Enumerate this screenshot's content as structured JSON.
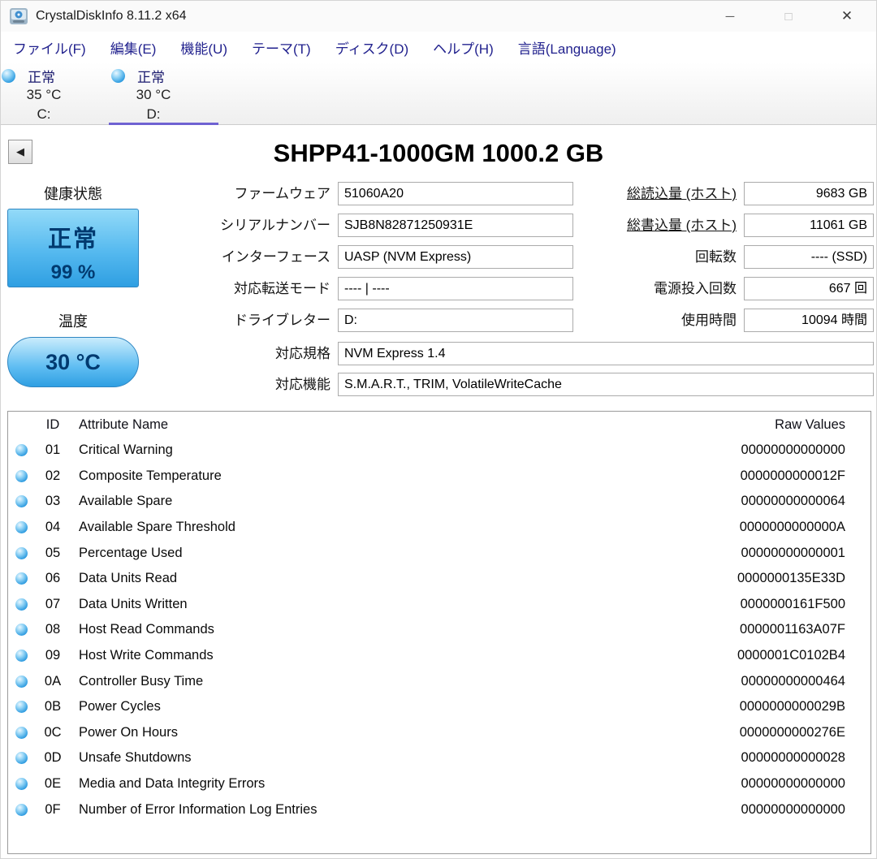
{
  "window": {
    "title": "CrystalDiskInfo 8.11.2 x64",
    "controls": {
      "minimize": "─",
      "maximize": "□",
      "close": "✕"
    }
  },
  "menu": {
    "items": [
      {
        "label": "ファイル(F)"
      },
      {
        "label": "編集(E)"
      },
      {
        "label": "機能(U)"
      },
      {
        "label": "テーマ(T)"
      },
      {
        "label": "ディスク(D)"
      },
      {
        "label": "ヘルプ(H)"
      },
      {
        "label": "言語(Language)"
      }
    ]
  },
  "drive_tabs": [
    {
      "status": "正常",
      "temperature": "35 °C",
      "letter": "C:",
      "selected": false
    },
    {
      "status": "正常",
      "temperature": "30 °C",
      "letter": "D:",
      "selected": true
    }
  ],
  "disk": {
    "title": "SHPP41-1000GM 1000.2 GB",
    "back_glyph": "◀",
    "health": {
      "label": "健康状態",
      "status": "正常",
      "percent": "99 %"
    },
    "temperature": {
      "label": "温度",
      "value": "30 °C"
    },
    "left_fields": [
      {
        "label": "ファームウェア",
        "value": "51060A20"
      },
      {
        "label": "シリアルナンバー",
        "value": "SJB8N82871250931E"
      },
      {
        "label": "インターフェース",
        "value": "UASP (NVM Express)"
      },
      {
        "label": "対応転送モード",
        "value": "---- | ----"
      },
      {
        "label": "ドライブレター",
        "value": "D:"
      }
    ],
    "right_fields": [
      {
        "label": "総読込量 (ホスト)",
        "value": "9683 GB",
        "underline": true
      },
      {
        "label": "総書込量 (ホスト)",
        "value": "11061 GB",
        "underline": true
      },
      {
        "label": "回転数",
        "value": "---- (SSD)"
      },
      {
        "label": "電源投入回数",
        "value": "667 回"
      },
      {
        "label": "使用時間",
        "value": "10094 時間"
      }
    ],
    "wide_fields": [
      {
        "label": "対応規格",
        "value": "NVM Express 1.4"
      },
      {
        "label": "対応機能",
        "value": "S.M.A.R.T., TRIM, VolatileWriteCache"
      }
    ]
  },
  "smart": {
    "headers": {
      "id": "ID",
      "name": "Attribute Name",
      "raw": "Raw Values"
    },
    "rows": [
      {
        "id": "01",
        "name": "Critical Warning",
        "raw": "00000000000000"
      },
      {
        "id": "02",
        "name": "Composite Temperature",
        "raw": "0000000000012F"
      },
      {
        "id": "03",
        "name": "Available Spare",
        "raw": "00000000000064"
      },
      {
        "id": "04",
        "name": "Available Spare Threshold",
        "raw": "0000000000000A"
      },
      {
        "id": "05",
        "name": "Percentage Used",
        "raw": "00000000000001"
      },
      {
        "id": "06",
        "name": "Data Units Read",
        "raw": "0000000135E33D"
      },
      {
        "id": "07",
        "name": "Data Units Written",
        "raw": "0000000161F500"
      },
      {
        "id": "08",
        "name": "Host Read Commands",
        "raw": "0000001163A07F"
      },
      {
        "id": "09",
        "name": "Host Write Commands",
        "raw": "0000001C0102B4"
      },
      {
        "id": "0A",
        "name": "Controller Busy Time",
        "raw": "00000000000464"
      },
      {
        "id": "0B",
        "name": "Power Cycles",
        "raw": "0000000000029B"
      },
      {
        "id": "0C",
        "name": "Power On Hours",
        "raw": "0000000000276E"
      },
      {
        "id": "0D",
        "name": "Unsafe Shutdowns",
        "raw": "00000000000028"
      },
      {
        "id": "0E",
        "name": "Media and Data Integrity Errors",
        "raw": "00000000000000"
      },
      {
        "id": "0F",
        "name": "Number of Error Information Log Entries",
        "raw": "00000000000000"
      }
    ]
  },
  "colors": {
    "health_good_top": "#93daf8",
    "health_good_bottom": "#2f9fe2",
    "health_text": "#003a70",
    "menu_text": "#22228e",
    "selection_underline": "#6f62d2",
    "status_dot": "#2d9be0"
  }
}
